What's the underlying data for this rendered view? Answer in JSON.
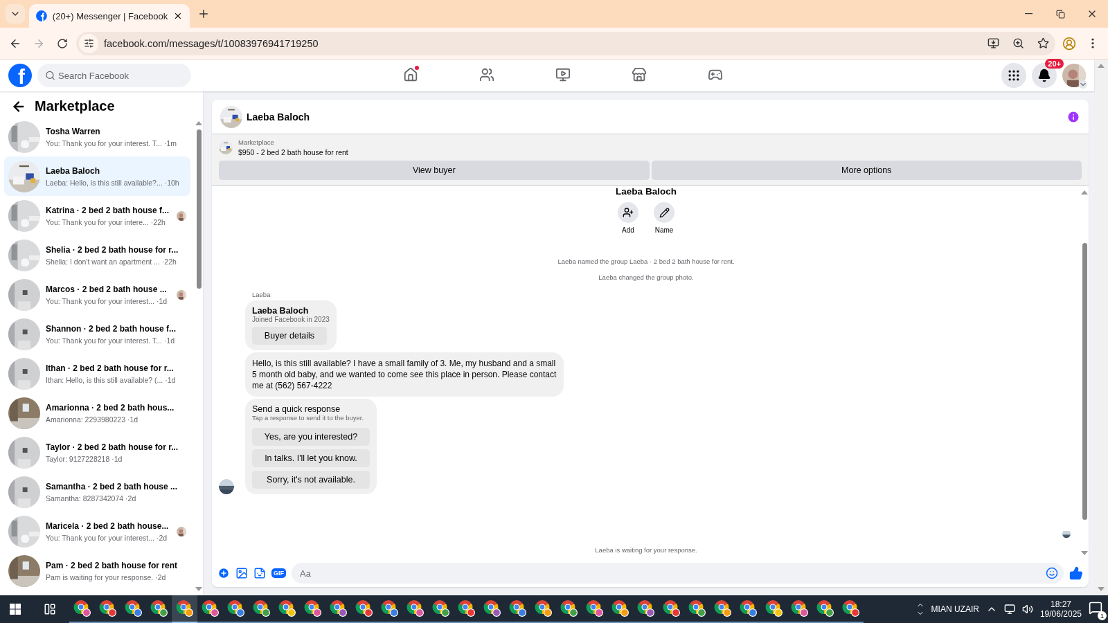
{
  "browser": {
    "tab_title": "(20+) Messenger | Facebook",
    "url": "facebook.com/messages/t/10083976941719250"
  },
  "header": {
    "logo": "f",
    "search": {
      "placeholder": "Search Facebook"
    },
    "nav": [
      {
        "kind": "home",
        "selected": false,
        "dot": true
      },
      {
        "kind": "friends",
        "selected": false,
        "dot": false
      },
      {
        "kind": "video",
        "selected": false,
        "dot": false
      },
      {
        "kind": "marketplace",
        "selected": false,
        "dot": false
      },
      {
        "kind": "gaming",
        "selected": false,
        "dot": false
      }
    ],
    "notifications_badge": "20+"
  },
  "sidebar": {
    "title": "Marketplace",
    "conversations": [
      {
        "name": "Tosha Warren",
        "preview": "You: Thank you for your interest. T...",
        "time": "·1m",
        "selected": false
      },
      {
        "name": "Laeba Baloch",
        "preview": "Laeba: Hello, is this still available?...",
        "time": "·10h",
        "selected": true
      },
      {
        "name": "Katrina · 2 bed 2 bath house f...",
        "preview": "You: Thank you for your intere...",
        "time": "·22h",
        "selected": false
      },
      {
        "name": "Shelia · 2 bed 2 bath house for r...",
        "preview": "Shelia: I don't want an apartment ...",
        "time": "·22h",
        "selected": false
      },
      {
        "name": "Marcos · 2 bed 2 bath house ...",
        "preview": "You: Thank you for your interest...",
        "time": "·1d",
        "selected": false
      },
      {
        "name": "Shannon · 2 bed 2 bath house f...",
        "preview": "You: Thank you for your interest. T...",
        "time": "·1d",
        "selected": false
      },
      {
        "name": "Ithan · 2 bed 2 bath house for r...",
        "preview": "Ithan: Hello, is this still available? (...",
        "time": "·1d",
        "selected": false
      },
      {
        "name": "Amarionna · 2 bed 2 bath hous...",
        "preview": "Amarionna: 2293980223",
        "time": "·1d",
        "selected": false
      },
      {
        "name": "Taylor · 2 bed 2 bath house for r...",
        "preview": "Taylor: 9127228218",
        "time": "·1d",
        "selected": false
      },
      {
        "name": "Samantha · 2 bed 2 bath house ...",
        "preview": "Samantha: 8287342074",
        "time": "·2d",
        "selected": false
      },
      {
        "name": "Maricela · 2 bed 2 bath house...",
        "preview": "You: Thank you for your interest...",
        "time": "·2d",
        "selected": false
      },
      {
        "name": "Pam · 2 bed 2 bath house for rent",
        "preview": "Pam is waiting for your response.",
        "time": "·2d",
        "selected": false
      }
    ]
  },
  "chat": {
    "name": "Laeba Baloch",
    "listing": {
      "label": "Marketplace",
      "title": "$950 - 2 bed 2 bath house for rent",
      "buttons": [
        "View buyer",
        "More options"
      ]
    },
    "group": {
      "name": "Laeba Baloch",
      "actions": [
        {
          "kind": "add",
          "label": "Add"
        },
        {
          "kind": "name",
          "label": "Name"
        }
      ]
    },
    "events": [
      "Laeba named the group Laeba · 2 bed 2 bath house for rent.",
      "Laeba changed the group photo."
    ],
    "sender": "Laeba",
    "profile_card": {
      "name": "Laeba Baloch",
      "subtitle": "Joined Facebook in 2023",
      "button": "Buyer details"
    },
    "message": "Hello, is this still available? I have a small family of 3. Me, my husband and a small 5 month old baby, and we wanted to come see this place in person. Please contact me at (562) 567-4222",
    "quick_response": {
      "title": "Send a quick response",
      "subtitle": "Tap a response to send it to the buyer.",
      "options": [
        "Yes, are you interested?",
        "In talks. I'll let you know.",
        "Sorry, it's not available."
      ]
    },
    "status": "Laeba is waiting for your response.",
    "composer": {
      "gif": "GIF",
      "placeholder": "Aa"
    }
  },
  "taskbar": {
    "apps": [
      {
        "color": "#e0569b",
        "selected": false
      },
      {
        "color": "#e53935",
        "selected": false
      },
      {
        "color": "#3b7de0",
        "selected": false
      },
      {
        "color": "#43a047",
        "selected": false
      },
      {
        "color": "#f39c12",
        "selected": true
      },
      {
        "color": "#e0569b",
        "selected": false
      },
      {
        "color": "#3b7de0",
        "selected": false
      },
      {
        "color": "#43a047",
        "selected": false
      },
      {
        "color": "#f1c40f",
        "selected": false
      },
      {
        "color": "#e0569b",
        "selected": false
      },
      {
        "color": "#9b59b6",
        "selected": false
      },
      {
        "color": "#e53935",
        "selected": false
      },
      {
        "color": "#3b7de0",
        "selected": false
      },
      {
        "color": "#e0569b",
        "selected": false
      },
      {
        "color": "#43a047",
        "selected": false
      },
      {
        "color": "#e53935",
        "selected": false
      },
      {
        "color": "#9b59b6",
        "selected": false
      },
      {
        "color": "#3b7de0",
        "selected": false
      },
      {
        "color": "#f39c12",
        "selected": false
      },
      {
        "color": "#43a047",
        "selected": false
      },
      {
        "color": "#e0569b",
        "selected": false
      },
      {
        "color": "#f39c12",
        "selected": false
      },
      {
        "color": "#9b59b6",
        "selected": false
      },
      {
        "color": "#e53935",
        "selected": false
      },
      {
        "color": "#43a047",
        "selected": false
      },
      {
        "color": "#f39c12",
        "selected": false
      },
      {
        "color": "#3b7de0",
        "selected": false
      },
      {
        "color": "#f1c40f",
        "selected": false
      },
      {
        "color": "#e0569b",
        "selected": false
      },
      {
        "color": "#43a047",
        "selected": false
      },
      {
        "color": "#e53935",
        "selected": false
      }
    ],
    "user": "MIAN UZAIR",
    "time": "18:27",
    "date": "19/06/2025",
    "notifications": "1"
  }
}
